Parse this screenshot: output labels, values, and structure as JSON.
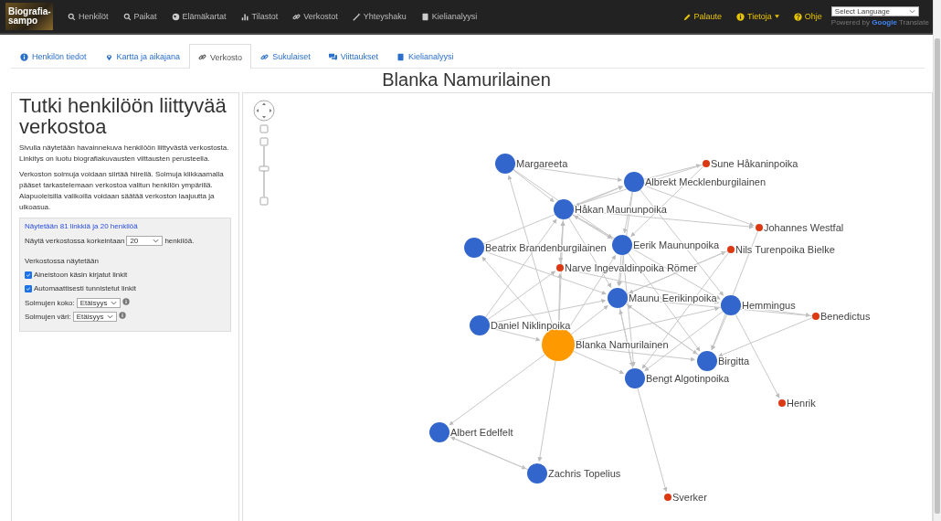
{
  "navbar": {
    "logo": [
      "Biografia-",
      "sampo"
    ],
    "items": [
      {
        "label": "Henkilöt"
      },
      {
        "label": "Paikat"
      },
      {
        "label": "Elämäkartat"
      },
      {
        "label": "Tilastot"
      },
      {
        "label": "Verkostot"
      },
      {
        "label": "Yhteyshaku"
      },
      {
        "label": "Kielianalyysi"
      }
    ],
    "right_items": [
      {
        "label": "Palaute"
      },
      {
        "label": "Tietoja"
      },
      {
        "label": "Ohje"
      }
    ],
    "language": {
      "value": "Select Language",
      "powered_by": "Powered by",
      "brand": "Google",
      "product": "Translate"
    }
  },
  "tabs": [
    {
      "label": "Henkilön tiedot",
      "selected": false
    },
    {
      "label": "Kartta ja aikajana",
      "selected": false
    },
    {
      "label": "Verkosto",
      "selected": true
    },
    {
      "label": "Sukulaiset",
      "selected": false
    },
    {
      "label": "Viittaukset",
      "selected": false
    },
    {
      "label": "Kielianalyysi",
      "selected": false
    }
  ],
  "title": "Blanka Namurilainen",
  "sidebar": {
    "heading": "Tutki henkilöön liittyvää verkostoa",
    "paragraphs": [
      "Sivulla näytetään havainnekuva henkilöön liittyvästä verkostosta. Linkitys on luotu biografiakuvausten viittausten perusteella.",
      "Verkoston solmuja voidaan siirtää hiirellä. Solmuja klikkaamalla pääset tarkastelemaan verkostoa valitun henkilön ympärillä. Alapuoleisilla valikoilla voidaan säätää verkoston laajuutta ja ulkoasua."
    ],
    "summary": "Näytetään 81 linkkiä ja 20 henkilöä",
    "limit": {
      "before": "Näytä verkostossa korkeintaan",
      "value": "20",
      "after": "henkilöä."
    },
    "shown_heading": "Verkostossa näytetään",
    "checkboxes": [
      {
        "label": "Aineistoon käsin kirjatut linkit",
        "checked": true
      },
      {
        "label": "Automaattisesti tunnistetut linkit",
        "checked": true
      }
    ],
    "selects": [
      {
        "label": "Solmujen koko:",
        "value": "Etäisyys"
      },
      {
        "label": "Solmujen väri:",
        "value": "Etäisyys"
      }
    ]
  },
  "network": {
    "nodes": [
      {
        "label": "Margareeta",
        "kind": "person",
        "color": "#3366cc"
      },
      {
        "label": "Albrekt Mecklenburgilainen",
        "kind": "person",
        "color": "#3366cc"
      },
      {
        "label": "Sune Håkaninpoika",
        "kind": "minor",
        "color": "#dc3912"
      },
      {
        "label": "Håkan Maununpoika",
        "kind": "person",
        "color": "#3366cc"
      },
      {
        "label": "Johannes Westfal",
        "kind": "minor",
        "color": "#dc3912"
      },
      {
        "label": "Beatrix Brandenburgilainen",
        "kind": "person",
        "color": "#3366cc"
      },
      {
        "label": "Eerik Maununpoika",
        "kind": "person",
        "color": "#3366cc"
      },
      {
        "label": "Nils Turenpoika Bielke",
        "kind": "minor",
        "color": "#dc3912"
      },
      {
        "label": "Narve Ingevaldinpoika Römer",
        "kind": "minor",
        "color": "#dc3912"
      },
      {
        "label": "Maunu Eerikinpoika",
        "kind": "person",
        "color": "#3366cc"
      },
      {
        "label": "Hemmingus",
        "kind": "person",
        "color": "#3366cc"
      },
      {
        "label": "Benedictus",
        "kind": "minor",
        "color": "#dc3912"
      },
      {
        "label": "Daniel Niklinpoika",
        "kind": "person",
        "color": "#3366cc"
      },
      {
        "label": "Blanka Namurilainen",
        "kind": "focus",
        "color": "#ff9900"
      },
      {
        "label": "Birgitta",
        "kind": "person",
        "color": "#3366cc"
      },
      {
        "label": "Bengt Algotinpoika",
        "kind": "person",
        "color": "#3366cc"
      },
      {
        "label": "Henrik",
        "kind": "minor",
        "color": "#dc3912"
      },
      {
        "label": "Albert Edelfelt",
        "kind": "person",
        "color": "#3366cc"
      },
      {
        "label": "Zachris Topelius",
        "kind": "person",
        "color": "#3366cc"
      },
      {
        "label": "Sverker",
        "kind": "minor",
        "color": "#dc3912"
      }
    ]
  }
}
